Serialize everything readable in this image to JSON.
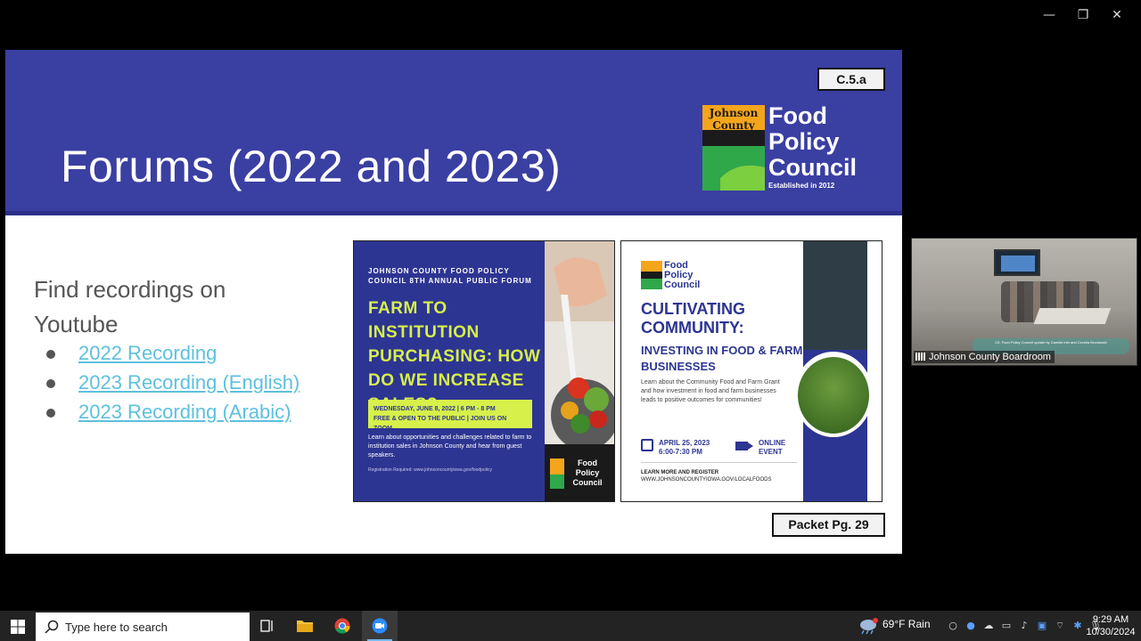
{
  "window": {
    "minimize_glyph": "—",
    "restore_glyph": "❐",
    "close_glyph": "✕"
  },
  "slide": {
    "title": "Forums (2022 and 2023)",
    "badge_top": "C.5.a",
    "badge_bottom": "Packet Pg. 29",
    "logo": {
      "line1": "Food",
      "line2": "Policy",
      "line3": "Council",
      "established": "Established in 2012"
    },
    "find_text": "Find recordings on Youtube",
    "recordings": [
      {
        "label": "2022 Recording"
      },
      {
        "label": "2023 Recording (English)"
      },
      {
        "label": "2023 Recording (Arabic)"
      }
    ]
  },
  "poster1": {
    "org": "JOHNSON COUNTY FOOD POLICY COUNCIL 8TH ANNUAL PUBLIC FORUM",
    "title": "FARM TO INSTITUTION PURCHASING: HOW DO WE INCREASE SALES?",
    "date_line1": "WEDNESDAY, JUNE 8, 2022 | 6 PM - 8 PM",
    "date_line2": "FREE & OPEN TO THE PUBLIC | JOIN US ON ZOOM",
    "description": "Learn about opportunities and challenges related to farm to institution sales in Johnson County and hear from guest speakers.",
    "registration": "Registration Required: www.johnsoncountyiowa.gov/foodpolicy",
    "logo_text": "Food Policy Council"
  },
  "poster2": {
    "logo_text": "Food Policy Council",
    "title": "CULTIVATING COMMUNITY:",
    "subtitle": "INVESTING IN FOOD & FARM BUSINESSES",
    "description": "Learn about the Community Food and Farm Grant and how investment in food and farm businesses leads to positive outcomes for communities!",
    "date_line1": "APRIL 25, 2023",
    "date_line2": "6:00-7:30 PM",
    "online_line1": "ONLINE",
    "online_line2": "EVENT",
    "learn_line1": "LEARN MORE AND REGISTER",
    "learn_line2": "WWW.JOHNSONCOUNTYIOWA.GOV/LOCALFOODS"
  },
  "video_tile": {
    "participant_name": "Johnson County Boardroom",
    "caption": "C5. Food Policy Council update by Camille Intri and Cecelia Brodowski"
  },
  "taskbar": {
    "search_placeholder": "Type here to search",
    "weather": "69°F  Rain",
    "time": "9:29 AM",
    "date": "10/30/2024"
  },
  "colors": {
    "slide_header": "#3a3fa2",
    "link": "#5ec0de",
    "poster_blue": "#2d3592",
    "poster_lime": "#d7f04a"
  }
}
